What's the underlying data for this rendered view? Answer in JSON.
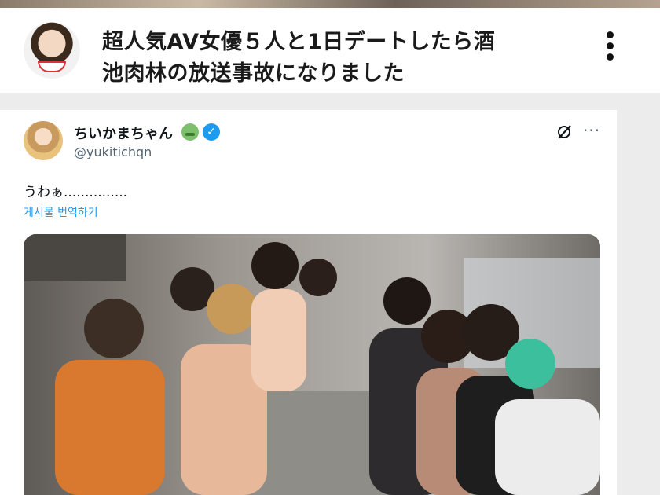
{
  "video": {
    "title_line1": "超人気AV女優５人と1日デートしたら酒",
    "title_line2": "池肉林の放送事故になりました",
    "menu_icon": "kebab-vertical-icon"
  },
  "tweet": {
    "display_name": "ちいかまちゃん",
    "name_emoji": "nauseated-face-emoji",
    "verified_icon": "verified-badge-icon",
    "handle": "@yukitichqn",
    "text": "うわぁ...............",
    "translate_label": "게시물 번역하기",
    "grok_icon": "grok-icon",
    "more_icon": "more-horizontal-icon",
    "more_glyph": "···",
    "verified_glyph": "✓",
    "photo_description_icon": "photo-icon"
  },
  "colors": {
    "accent_blue": "#1d9bf0",
    "handle_gray": "#536471",
    "text_dark": "#0f1419"
  }
}
